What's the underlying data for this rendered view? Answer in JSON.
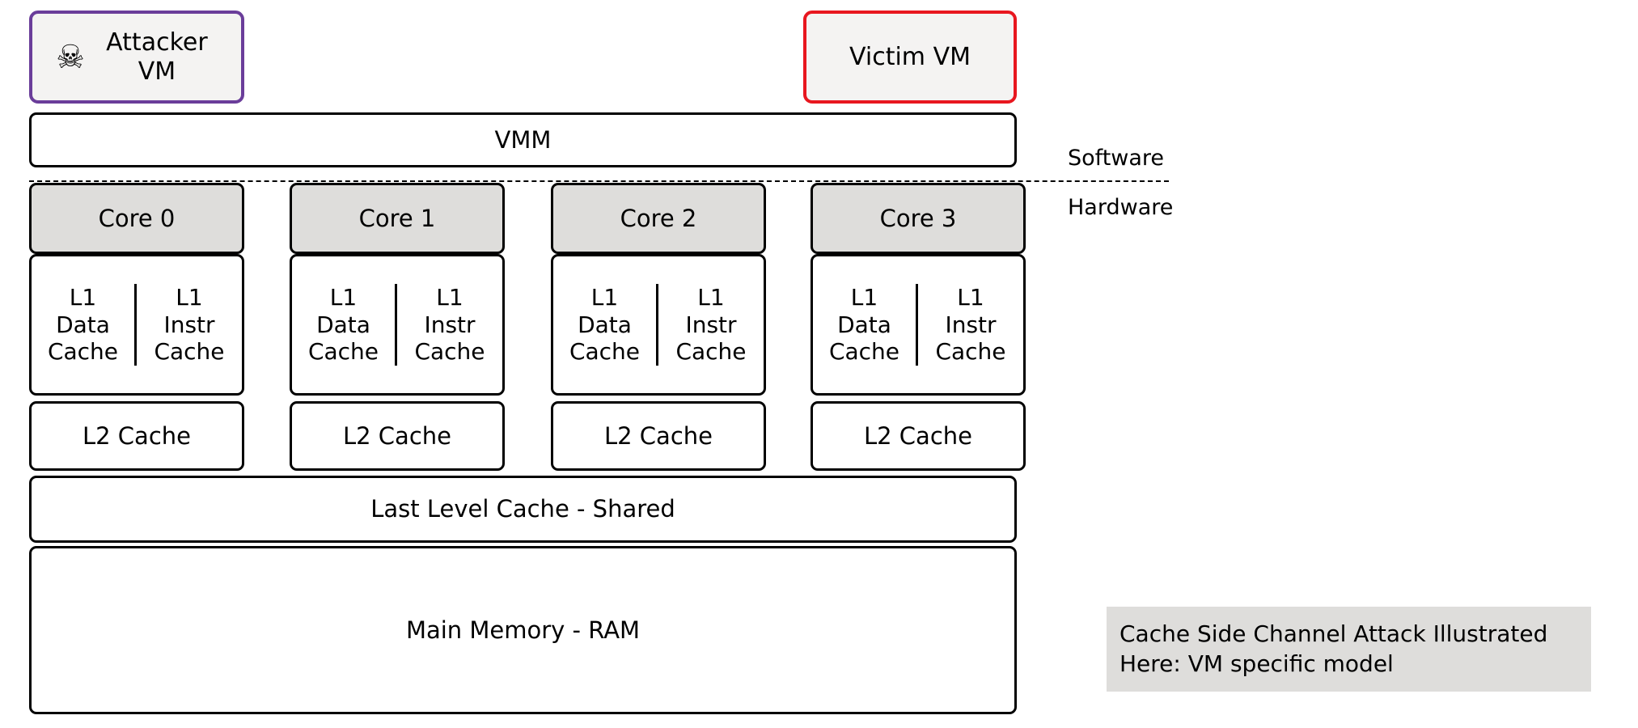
{
  "diagram": {
    "vms": [
      {
        "id": "attacker",
        "label": "Attacker VM",
        "icon": "skull-and-crossbones-icon",
        "glyph": "☠",
        "border_color": "#6a3d9a",
        "fill_color": "#f4f3f2"
      },
      {
        "id": "victim",
        "label": "Victim VM",
        "border_color": "#e8171f",
        "fill_color": "#f4f3f2"
      }
    ],
    "vmm": {
      "label": "VMM"
    },
    "layers": {
      "software_label": "Software",
      "hardware_label": "Hardware",
      "divider_style": "dashed"
    },
    "cores": [
      {
        "name": "Core 0",
        "l1_data": {
          "line1": "L1",
          "line2": "Data",
          "line3": "Cache"
        },
        "l1_instr": {
          "line1": "L1",
          "line2": "Instr",
          "line3": "Cache"
        },
        "l2": "L2 Cache"
      },
      {
        "name": "Core 1",
        "l1_data": {
          "line1": "L1",
          "line2": "Data",
          "line3": "Cache"
        },
        "l1_instr": {
          "line1": "L1",
          "line2": "Instr",
          "line3": "Cache"
        },
        "l2": "L2 Cache"
      },
      {
        "name": "Core 2",
        "l1_data": {
          "line1": "L1",
          "line2": "Data",
          "line3": "Cache"
        },
        "l1_instr": {
          "line1": "L1",
          "line2": "Instr",
          "line3": "Cache"
        },
        "l2": "L2 Cache"
      },
      {
        "name": "Core 3",
        "l1_data": {
          "line1": "L1",
          "line2": "Data",
          "line3": "Cache"
        },
        "l1_instr": {
          "line1": "L1",
          "line2": "Instr",
          "line3": "Cache"
        },
        "l2": "L2 Cache"
      }
    ],
    "shared": {
      "last_level_cache": "Last Level Cache - Shared",
      "main_memory": "Main Memory - RAM"
    },
    "caption": {
      "line1": "Cache Side Channel Attack Illustrated",
      "line2": "Here: VM specific model",
      "fill_color": "#dedddb"
    },
    "colors": {
      "core_fill": "#dedddb",
      "box_fill": "#ffffff",
      "stroke": "#000000"
    }
  }
}
